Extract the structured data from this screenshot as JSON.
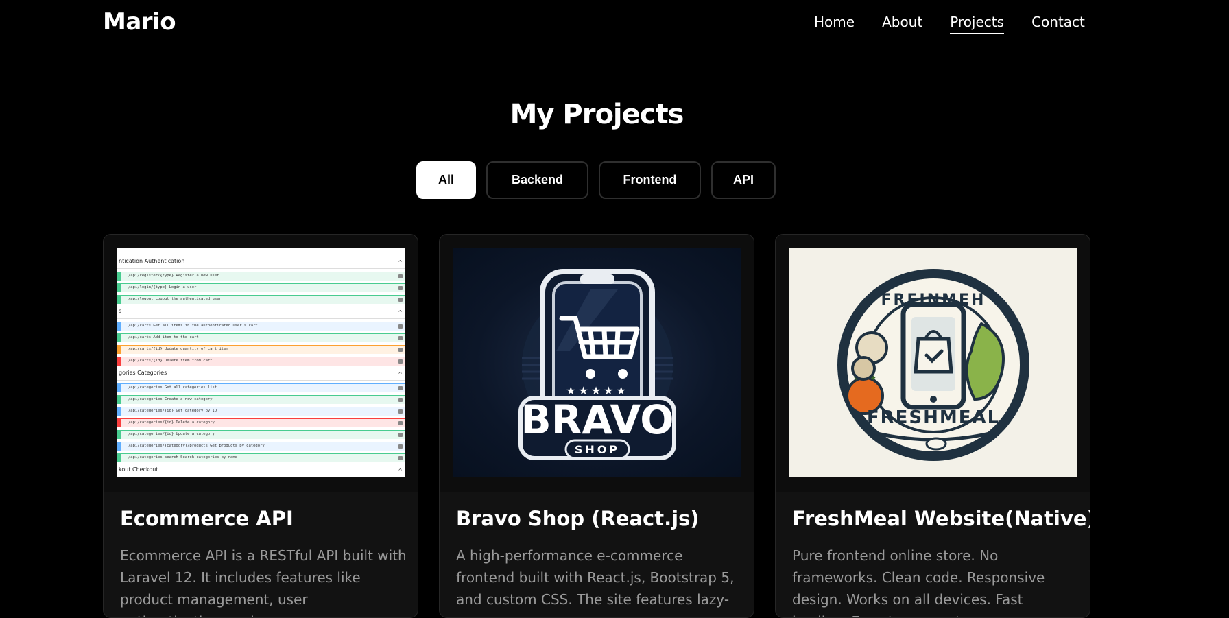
{
  "navbar": {
    "brand": "Mario",
    "links": [
      {
        "label": "Home",
        "active": false
      },
      {
        "label": "About",
        "active": false
      },
      {
        "label": "Projects",
        "active": true
      },
      {
        "label": "Contact",
        "active": false
      }
    ]
  },
  "section": {
    "title": "My Projects"
  },
  "filters": [
    {
      "label": "All",
      "active": true
    },
    {
      "label": "Backend",
      "active": false
    },
    {
      "label": "Frontend",
      "active": false
    },
    {
      "label": "API",
      "active": false
    }
  ],
  "projects": [
    {
      "title": "Ecommerce API",
      "description": "Ecommerce API is a RESTful API built with Laravel 12. It includes features like product management, user authentication, and",
      "image": "api-docs-screenshot",
      "api_sections": [
        {
          "head": "ntication",
          "sub": "Authentication"
        },
        {
          "head": "s",
          "sub": ""
        },
        {
          "head": "gories",
          "sub": "Categories"
        },
        {
          "head": "kout",
          "sub": "Checkout"
        }
      ],
      "api_rows": [
        "/api/register/{type}  Register a new user",
        "/api/login/{type}  Login a user",
        "/api/logout  Logout the authenticated user",
        "/api/carts  Get all items in the authenticated user's cart",
        "/api/carts  Add item to the cart",
        "/api/carts/{id}  Update quantity of cart item",
        "/api/carts/{id}  Delete item from cart",
        "/api/categories  Get all categories list",
        "/api/categories  Create a new category",
        "/api/categories/{id}  Get category by ID",
        "/api/categories/{id}  Delete a category",
        "/api/categories/{id}  Update a category",
        "/api/categories/{category}/products  Get products by category",
        "/api/categories-search  Search categories by name"
      ]
    },
    {
      "title": "Bravo Shop (React.js)",
      "description": "A high-performance e-commerce frontend built with React.js, Bootstrap 5, and custom CSS. The site features lazy-",
      "image": "bravo-shop-logo",
      "logo_main": "BRAVO",
      "logo_sub": "SHOP",
      "stars": "★★★★★"
    },
    {
      "title": "FreshMeal Website(Native)",
      "description": "Pure frontend online store. No frameworks. Clean code. Responsive design. Works on all devices. Fast loading. Easy to connect",
      "image": "freshmeal-logo",
      "logo_top": "FREINMEH",
      "logo_bottom": "FRESHMEAL"
    }
  ],
  "colors": {
    "background": "#000000",
    "card": "#121212",
    "border": "#262626",
    "muted_text": "#9a9a9a",
    "api_get": "#61affe",
    "api_post": "#49cc90",
    "api_put": "#fca130",
    "api_delete": "#f93e3e"
  }
}
